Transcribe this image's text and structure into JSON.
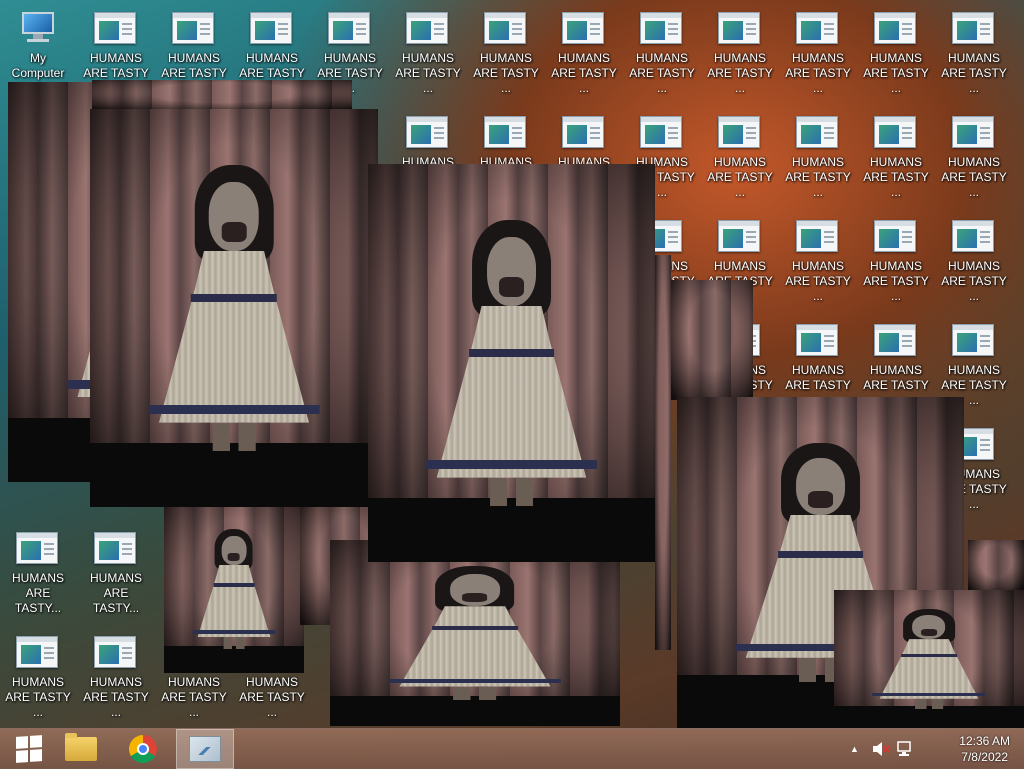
{
  "desktop": {
    "my_computer_label": "My Computer",
    "file_icon_label_line1": "HUMANS",
    "file_icon_label_line2": "ARE TASTY ...",
    "file_icon_label_line2_alt": "ARE TASTY...",
    "partial_labels": [
      "D",
      "A",
      "AR"
    ]
  },
  "taskbar": {
    "start_button": "start-icon",
    "pinned": [
      "file-explorer-icon",
      "chrome-icon",
      "resource-monitor-icon"
    ],
    "tray": {
      "show_hidden_icon": "▲",
      "volume_icon": "volume-muted-icon",
      "network_icon": "network-icon"
    },
    "clock_time": "12:36 AM",
    "clock_date": "7/8/2022"
  },
  "colors": {
    "taskbar": "#8a6050",
    "accent_orange": "#e0572a"
  }
}
